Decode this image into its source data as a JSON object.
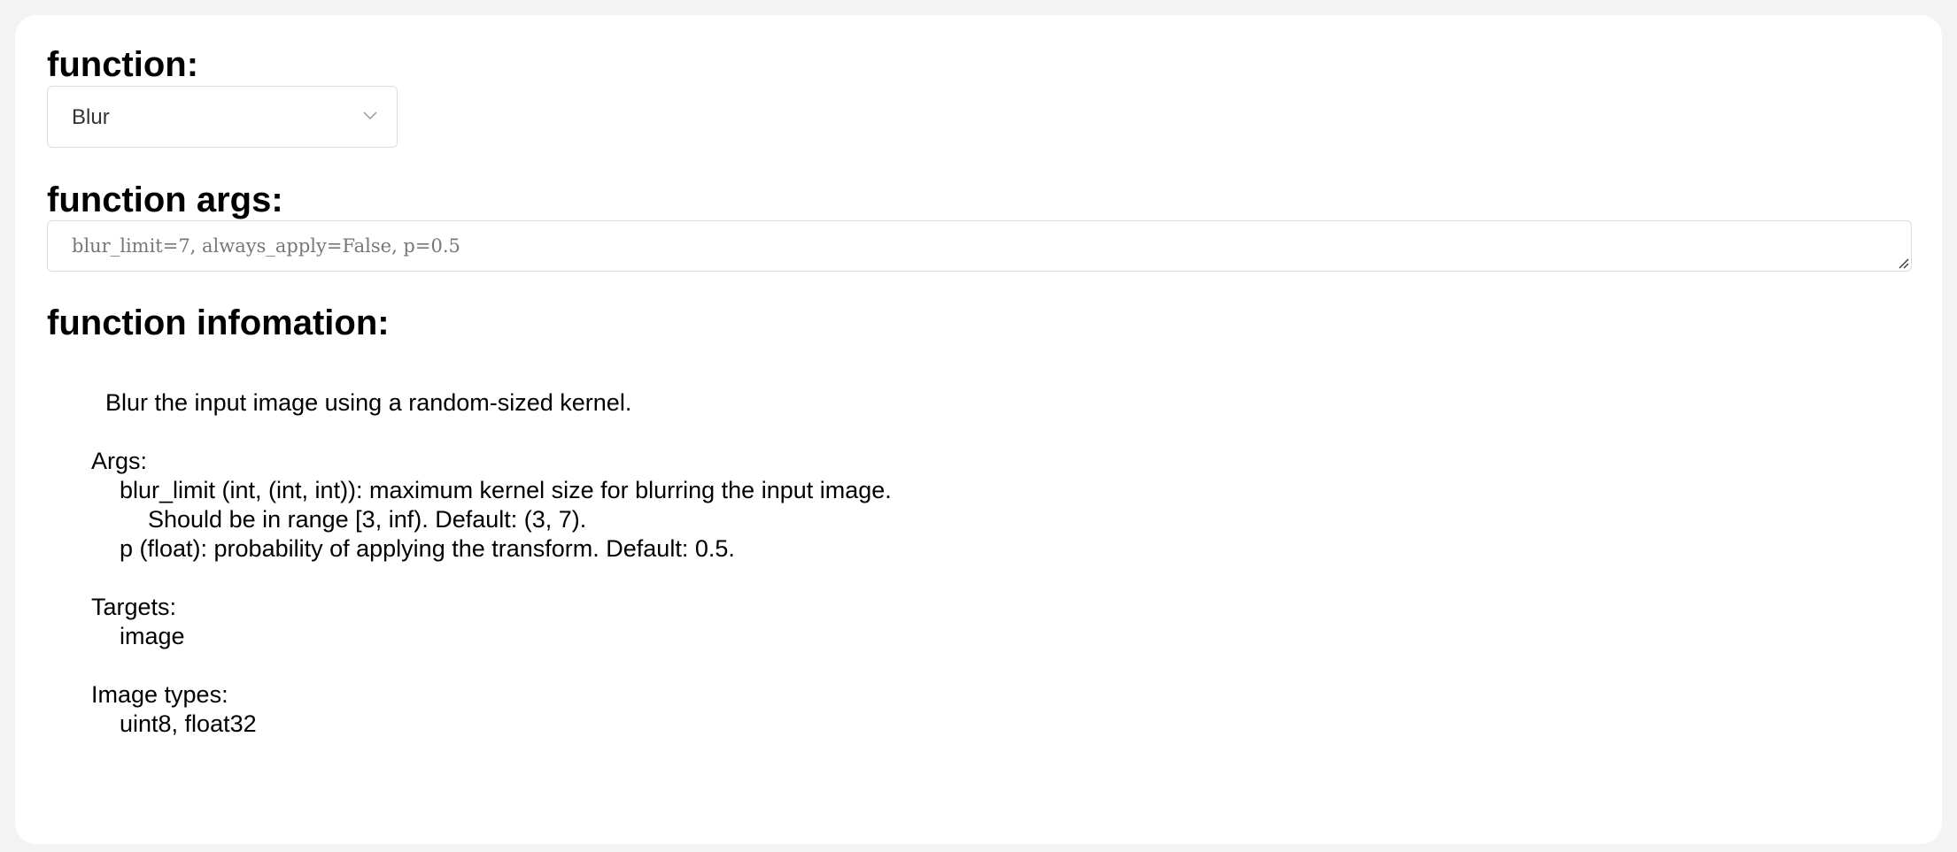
{
  "function_section": {
    "heading": "function:",
    "selected": "Blur"
  },
  "args_section": {
    "heading": "function args:",
    "value": "blur_limit=7, always_apply=False, p=0.5"
  },
  "info_section": {
    "heading": "function infomation:",
    "summary": "Blur the input image using a random-sized kernel.",
    "args_label": "Args:",
    "arg_blur_limit": "blur_limit (int, (int, int)): maximum kernel size for blurring the input image.",
    "arg_blur_limit_cont": "Should be in range [3, inf). Default: (3, 7).",
    "arg_p": "p (float): probability of applying the transform. Default: 0.5.",
    "targets_label": "Targets:",
    "targets_value": "image",
    "image_types_label": "Image types:",
    "image_types_value": "uint8, float32"
  },
  "icons": {
    "dropdown": "chevron-down-icon",
    "resize": "resize-grip-icon"
  }
}
